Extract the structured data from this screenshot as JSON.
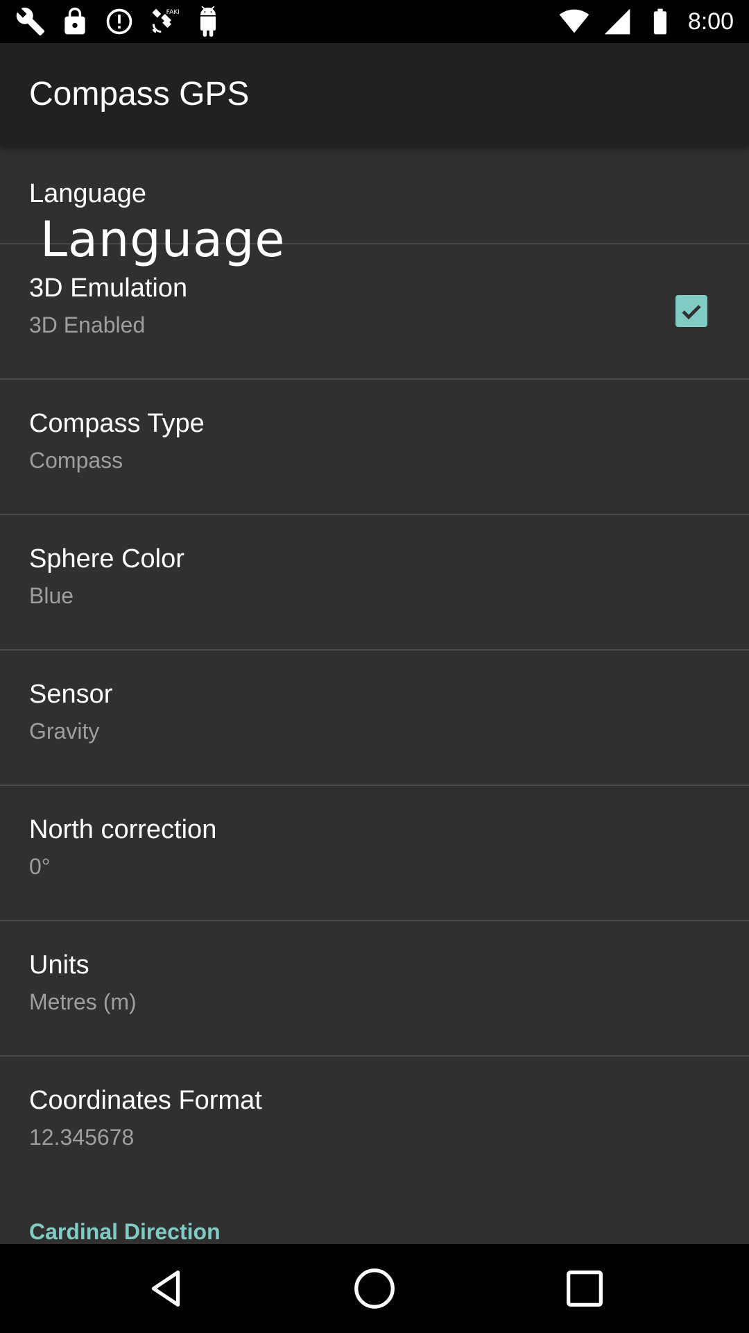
{
  "status_bar": {
    "time": "8:00",
    "icons": [
      "wrench-icon",
      "lock-icon",
      "alert-icon",
      "fake-gps-satellite-icon",
      "android-icon",
      "wifi-icon",
      "cellular-icon",
      "battery-icon"
    ]
  },
  "app_bar": {
    "title": "Compass GPS"
  },
  "preferences": [
    {
      "title": "Language",
      "summary": "",
      "big_text": "Language"
    },
    {
      "title": "3D Emulation",
      "summary": "3D Enabled",
      "checked": true
    },
    {
      "title": "Compass Type",
      "summary": "Compass"
    },
    {
      "title": "Sphere Color",
      "summary": "Blue"
    },
    {
      "title": "Sensor",
      "summary": "Gravity"
    },
    {
      "title": "North correction",
      "summary": "0°"
    },
    {
      "title": "Units",
      "summary": "Metres (m)"
    },
    {
      "title": "Coordinates Format",
      "summary": "12.345678"
    }
  ],
  "category": {
    "title": "Cardinal Direction"
  },
  "colors": {
    "background": "#303030",
    "app_bar": "#212121",
    "accent": "#80cbc4",
    "summary_text": "#9e9e9e"
  },
  "nav_bar": {
    "buttons": [
      "back-icon",
      "home-icon",
      "recents-icon"
    ]
  }
}
